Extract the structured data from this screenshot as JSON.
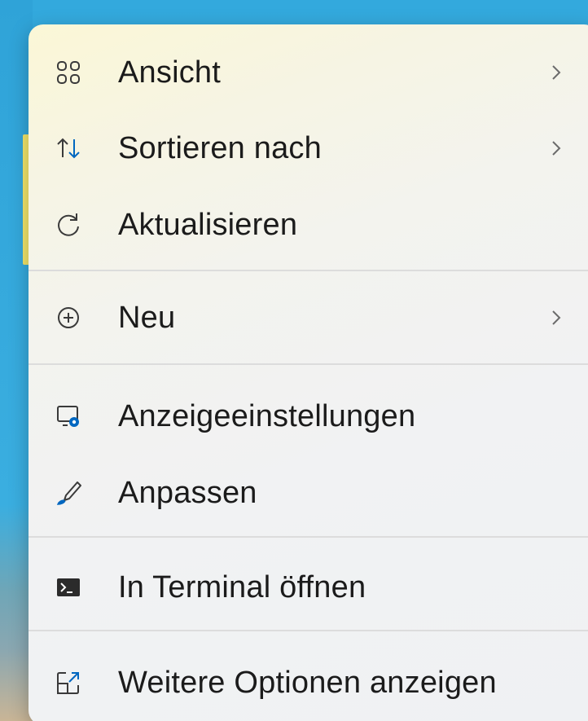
{
  "menu": {
    "items": [
      {
        "id": "view",
        "label": "Ansicht",
        "icon": "grid-icon",
        "has_submenu": true
      },
      {
        "id": "sort",
        "label": "Sortieren nach",
        "icon": "sort-icon",
        "has_submenu": true
      },
      {
        "id": "refresh",
        "label": "Aktualisieren",
        "icon": "refresh-icon",
        "has_submenu": false
      },
      {
        "id": "new",
        "label": "Neu",
        "icon": "plus-circle-icon",
        "has_submenu": true
      },
      {
        "id": "display",
        "label": "Anzeigeeinstellungen",
        "icon": "display-settings-icon",
        "has_submenu": false
      },
      {
        "id": "personalize",
        "label": "Anpassen",
        "icon": "brush-icon",
        "has_submenu": false
      },
      {
        "id": "terminal",
        "label": "In Terminal öffnen",
        "icon": "terminal-icon",
        "has_submenu": false
      },
      {
        "id": "more",
        "label": "Weitere Optionen anzeigen",
        "icon": "more-options-icon",
        "has_submenu": false
      }
    ]
  },
  "colors": {
    "text": "#1b1b1b",
    "icon": "#3a3a3a",
    "accent": "#0067c0",
    "separator": "#dcdcdc"
  }
}
